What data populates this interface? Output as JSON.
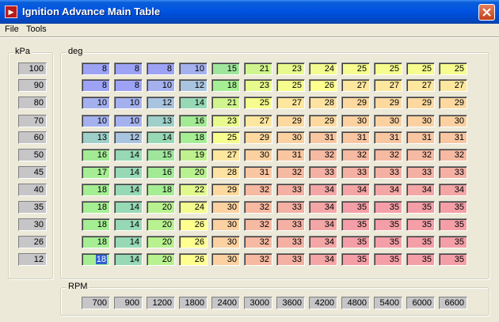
{
  "window": {
    "title": "Ignition Advance Main Table"
  },
  "menu": [
    "File",
    "Tools"
  ],
  "kpa": {
    "label": "kPa",
    "values": [
      "100",
      "90",
      "80",
      "70",
      "60",
      "50",
      "45",
      "40",
      "35",
      "30",
      "26",
      "12"
    ]
  },
  "table": {
    "label": "deg",
    "rows": [
      [
        "8",
        "8",
        "8",
        "10",
        "15",
        "21",
        "23",
        "24",
        "25",
        "25",
        "25",
        "25"
      ],
      [
        "8",
        "8",
        "10",
        "12",
        "18",
        "23",
        "25",
        "26",
        "27",
        "27",
        "27",
        "27"
      ],
      [
        "10",
        "10",
        "12",
        "14",
        "21",
        "25",
        "27",
        "28",
        "29",
        "29",
        "29",
        "29"
      ],
      [
        "10",
        "10",
        "13",
        "16",
        "23",
        "27",
        "29",
        "29",
        "30",
        "30",
        "30",
        "30"
      ],
      [
        "13",
        "12",
        "14",
        "18",
        "25",
        "29",
        "30",
        "31",
        "31",
        "31",
        "31",
        "31"
      ],
      [
        "16",
        "14",
        "15",
        "19",
        "27",
        "30",
        "31",
        "32",
        "32",
        "32",
        "32",
        "32"
      ],
      [
        "17",
        "14",
        "16",
        "20",
        "28",
        "31",
        "32",
        "33",
        "33",
        "33",
        "33",
        "33"
      ],
      [
        "18",
        "14",
        "18",
        "22",
        "29",
        "32",
        "33",
        "34",
        "34",
        "34",
        "34",
        "34"
      ],
      [
        "18",
        "14",
        "20",
        "24",
        "30",
        "32",
        "33",
        "34",
        "35",
        "35",
        "35",
        "35"
      ],
      [
        "18",
        "14",
        "20",
        "26",
        "30",
        "32",
        "33",
        "34",
        "35",
        "35",
        "35",
        "35"
      ],
      [
        "18",
        "14",
        "20",
        "26",
        "30",
        "32",
        "33",
        "34",
        "35",
        "35",
        "35",
        "35"
      ],
      [
        "18",
        "14",
        "20",
        "26",
        "30",
        "32",
        "33",
        "34",
        "35",
        "35",
        "35",
        "35"
      ]
    ],
    "selected_cell": {
      "row": 11,
      "col": 0
    },
    "colors": {
      "8": "#9da3f4",
      "10": "#a5b1ee",
      "12": "#a9c4de",
      "13": "#9fcfc9",
      "14": "#97d9b5",
      "15": "#9fe69c",
      "16": "#a3ea95",
      "17": "#a7ed95",
      "18": "#a6ee94",
      "19": "#bff28f",
      "20": "#b8f18f",
      "21": "#d1f58e",
      "22": "#e2f88c",
      "23": "#e8fa8d",
      "24": "#f5fc8f",
      "25": "#f6fd8e",
      "26": "#ffff90",
      "27": "#fde79e",
      "28": "#fde2a2",
      "29": "#fdd9a0",
      "30": "#fbd1a1",
      "31": "#f9c6a2",
      "32": "#f6b9a1",
      "33": "#f4b0a3",
      "34": "#f4a6a6",
      "35": "#f49fa7"
    },
    "selected_color": "#2f5fd0"
  },
  "rpm": {
    "label": "RPM",
    "values": [
      "700",
      "900",
      "1200",
      "1800",
      "2400",
      "3000",
      "3600",
      "4200",
      "4800",
      "5400",
      "6000",
      "6600"
    ]
  }
}
